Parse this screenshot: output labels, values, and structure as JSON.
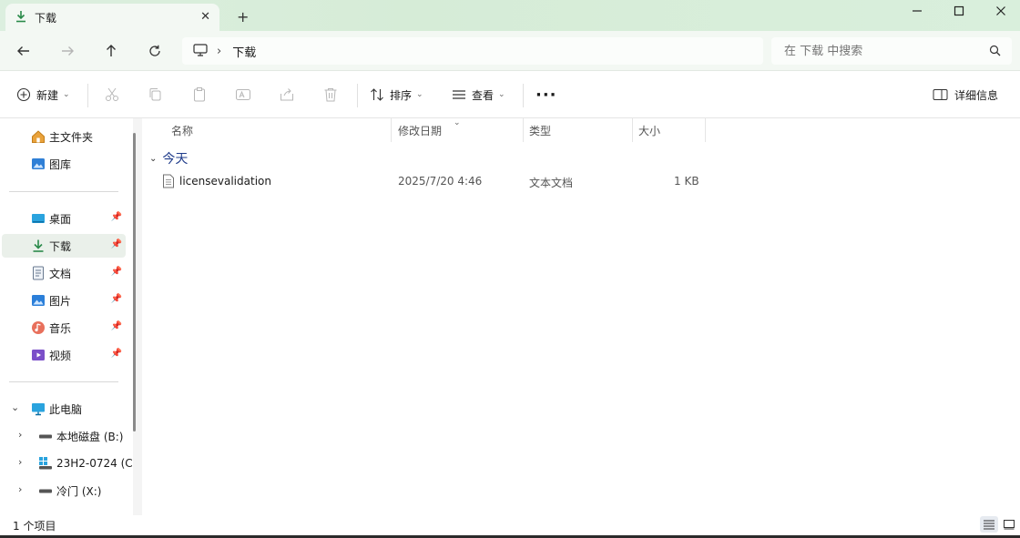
{
  "tab": {
    "title": "下载",
    "close_glyph": "✕",
    "new_tab_glyph": "+"
  },
  "window_controls": {
    "minimize": "—",
    "maximize": "☐",
    "close": "✕"
  },
  "address": {
    "breadcrumb": [
      "下载"
    ]
  },
  "search": {
    "placeholder": "在 下载 中搜索"
  },
  "commands": {
    "new_label": "新建",
    "sort_label": "排序",
    "view_label": "查看",
    "more_glyph": "···",
    "details_label": "详细信息"
  },
  "sidebar": {
    "top_items": [
      {
        "label": "主文件夹",
        "icon": "home-icon"
      },
      {
        "label": "图库",
        "icon": "gallery-icon"
      }
    ],
    "pinned_items": [
      {
        "label": "桌面",
        "icon": "desktop-icon"
      },
      {
        "label": "下载",
        "icon": "download-icon",
        "selected": true
      },
      {
        "label": "文档",
        "icon": "document-icon"
      },
      {
        "label": "图片",
        "icon": "pictures-icon"
      },
      {
        "label": "音乐",
        "icon": "music-icon"
      },
      {
        "label": "视频",
        "icon": "videos-icon"
      }
    ],
    "pc_label": "此电脑",
    "drives": [
      {
        "label": "本地磁盘 (B:)",
        "icon": "drive-icon"
      },
      {
        "label": "23H2-0724 (C",
        "icon": "system-drive-icon"
      },
      {
        "label": "冷门 (X:)",
        "icon": "drive-icon"
      }
    ]
  },
  "columns": {
    "name": "名称",
    "modified": "修改日期",
    "type": "类型",
    "size": "大小"
  },
  "group": {
    "label": "今天"
  },
  "files": [
    {
      "name": "licensevalidation",
      "modified": "2025/7/20 4:46",
      "type": "文本文档",
      "size": "1 KB"
    }
  ],
  "status": {
    "item_count": "1 个项目"
  },
  "colors": {
    "accent": "#2a8a4a",
    "title_bg": "#d6ecd7",
    "group_text": "#1f3b8a"
  }
}
